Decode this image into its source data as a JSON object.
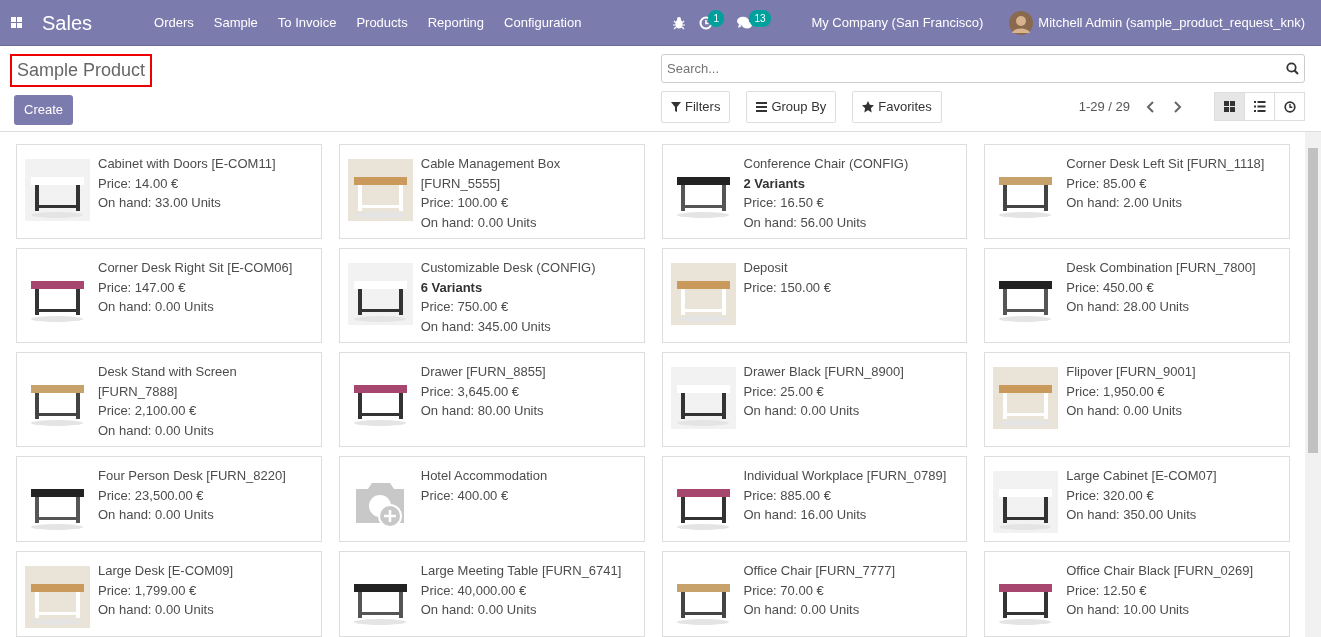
{
  "navbar": {
    "app": "Sales",
    "menu": [
      "Orders",
      "Sample",
      "To Invoice",
      "Products",
      "Reporting",
      "Configuration"
    ],
    "activity_count": "1",
    "message_count": "13",
    "company": "My Company (San Francisco)",
    "user": "Mitchell Admin (sample_product_request_knk)"
  },
  "control_panel": {
    "title": "Sample Product",
    "title_highlighted": true,
    "create": "Create",
    "search": {
      "placeholder": "Search..."
    },
    "filters": "Filters",
    "group_by": "Group By",
    "favorites": "Favorites",
    "pager": "1-29 / 29",
    "views": [
      {
        "kind": "kanban",
        "selected": true
      },
      {
        "kind": "list",
        "selected": false
      },
      {
        "kind": "activity",
        "selected": false
      }
    ]
  },
  "products": [
    {
      "name": "Cabinet with Doors [E-COM11]",
      "price": "Price: 14.00 €",
      "on_hand": "On hand: 33.00 Units",
      "kind": "picture"
    },
    {
      "name": "Cable Management Box [FURN_5555]",
      "price": "Price: 100.00 €",
      "on_hand": "On hand: 0.00 Units",
      "kind": "picture"
    },
    {
      "name": "Conference Chair (CONFIG)",
      "variants": "2 Variants",
      "price": "Price: 16.50 €",
      "on_hand": "On hand: 56.00 Units",
      "kind": "picture"
    },
    {
      "name": "Corner Desk Left Sit [FURN_1118]",
      "price": "Price: 85.00 €",
      "on_hand": "On hand: 2.00 Units",
      "kind": "picture"
    },
    {
      "name": "Corner Desk Right Sit [E-COM06]",
      "price": "Price: 147.00 €",
      "on_hand": "On hand: 0.00 Units",
      "kind": "picture"
    },
    {
      "name": "Customizable Desk (CONFIG)",
      "variants": "6 Variants",
      "price": "Price: 750.00 €",
      "on_hand": "On hand: 345.00 Units",
      "kind": "picture"
    },
    {
      "name": "Deposit",
      "price": "Price: 150.00 €",
      "kind": "picture"
    },
    {
      "name": "Desk Combination [FURN_7800]",
      "price": "Price: 450.00 €",
      "on_hand": "On hand: 28.00 Units",
      "kind": "picture"
    },
    {
      "name": "Desk Stand with Screen [FURN_7888]",
      "price": "Price: 2,100.00 €",
      "on_hand": "On hand: 0.00 Units",
      "kind": "picture"
    },
    {
      "name": "Drawer [FURN_8855]",
      "price": "Price: 3,645.00 €",
      "on_hand": "On hand: 80.00 Units",
      "kind": "picture"
    },
    {
      "name": "Drawer Black [FURN_8900]",
      "price": "Price: 25.00 €",
      "on_hand": "On hand: 0.00 Units",
      "kind": "picture"
    },
    {
      "name": "Flipover [FURN_9001]",
      "price": "Price: 1,950.00 €",
      "on_hand": "On hand: 0.00 Units",
      "kind": "picture"
    },
    {
      "name": "Four Person Desk [FURN_8220]",
      "price": "Price: 23,500.00 €",
      "on_hand": "On hand: 0.00 Units",
      "kind": "picture"
    },
    {
      "name": "Hotel Accommodation",
      "price": "Price: 400.00 €",
      "kind": "placeholder"
    },
    {
      "name": "Individual Workplace [FURN_0789]",
      "price": "Price: 885.00 €",
      "on_hand": "On hand: 16.00 Units",
      "kind": "picture"
    },
    {
      "name": "Large Cabinet [E-COM07]",
      "price": "Price: 320.00 €",
      "on_hand": "On hand: 350.00 Units",
      "kind": "picture"
    },
    {
      "name": "Large Desk [E-COM09]",
      "price": "Price: 1,799.00 €",
      "on_hand": "On hand: 0.00 Units",
      "kind": "picture"
    },
    {
      "name": "Large Meeting Table [FURN_6741]",
      "price": "Price: 40,000.00 €",
      "on_hand": "On hand: 0.00 Units",
      "kind": "picture"
    },
    {
      "name": "Office Chair [FURN_7777]",
      "price": "Price: 70.00 €",
      "on_hand": "On hand: 0.00 Units",
      "kind": "picture"
    },
    {
      "name": "Office Chair Black [FURN_0269]",
      "price": "Price: 12.50 €",
      "on_hand": "On hand: 10.00 Units",
      "kind": "picture"
    }
  ]
}
